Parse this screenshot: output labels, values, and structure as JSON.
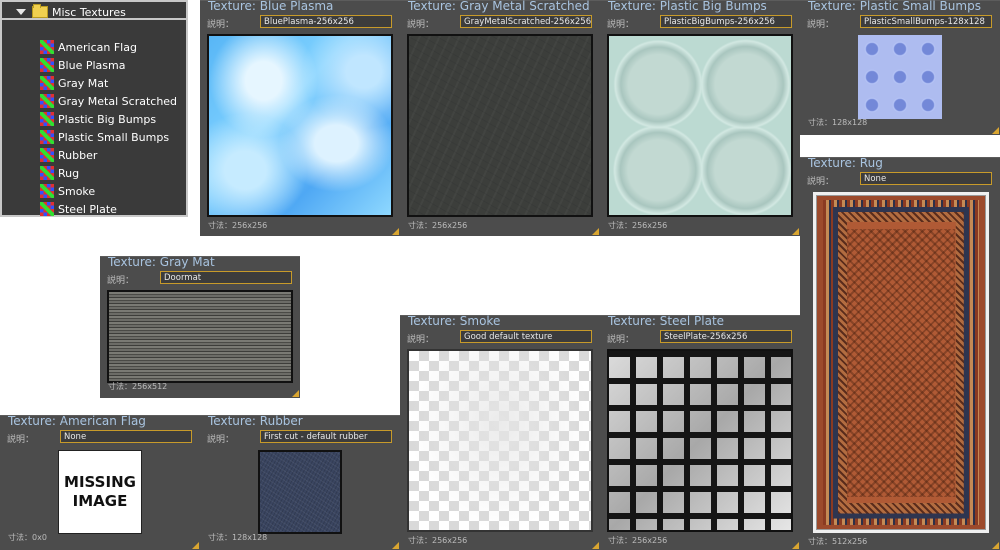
{
  "tree": {
    "root_label": "Misc Textures",
    "items": [
      "American Flag",
      "Blue Plasma",
      "Gray Mat",
      "Gray Metal Scratched",
      "Plastic Big Bumps",
      "Plastic Small Bumps",
      "Rubber",
      "Rug",
      "Smoke",
      "Steel Plate"
    ]
  },
  "panels": {
    "blue_plasma": {
      "title": "Texture: Blue Plasma",
      "desc_label": "説明：",
      "desc": "BluePlasma-256x256",
      "size": "寸法：256x256"
    },
    "gray_metal": {
      "title": "Texture: Gray Metal Scratched",
      "desc_label": "説明：",
      "desc": "GrayMetalScratched-256x256",
      "size": "寸法：256x256"
    },
    "big_bumps": {
      "title": "Texture: Plastic Big Bumps",
      "desc_label": "説明：",
      "desc": "PlasticBigBumps-256x256",
      "size": "寸法：256x256"
    },
    "small_bumps": {
      "title": "Texture: Plastic Small Bumps",
      "desc_label": "説明：",
      "desc": "PlasticSmallBumps-128x128",
      "size": "寸法：128x128"
    },
    "rug": {
      "title": "Texture: Rug",
      "desc_label": "説明：",
      "desc": "None",
      "size": "寸法：512x256"
    },
    "gray_mat": {
      "title": "Texture: Gray Mat",
      "desc_label": "説明：",
      "desc": "Doormat",
      "size": "寸法：256x512"
    },
    "smoke": {
      "title": "Texture: Smoke",
      "desc_label": "説明：",
      "desc": "Good default texture",
      "size": "寸法：256x256"
    },
    "steel_plate": {
      "title": "Texture: Steel Plate",
      "desc_label": "説明：",
      "desc": "SteelPlate-256x256",
      "size": "寸法：256x256"
    },
    "american_flag": {
      "title": "Texture: American Flag",
      "desc_label": "説明：",
      "desc": "None",
      "size": "寸法：0x0",
      "missing_line1": "MISSING",
      "missing_line2": "IMAGE"
    },
    "rubber": {
      "title": "Texture: Rubber",
      "desc_label": "説明：",
      "desc": "First cut - default rubber",
      "size": "寸法：128x128"
    }
  },
  "colors": {
    "panel_bg": "#4c4c4c",
    "title_text": "#a9c4e0",
    "field_border": "#c79a2a",
    "grip": "#d9a530"
  }
}
